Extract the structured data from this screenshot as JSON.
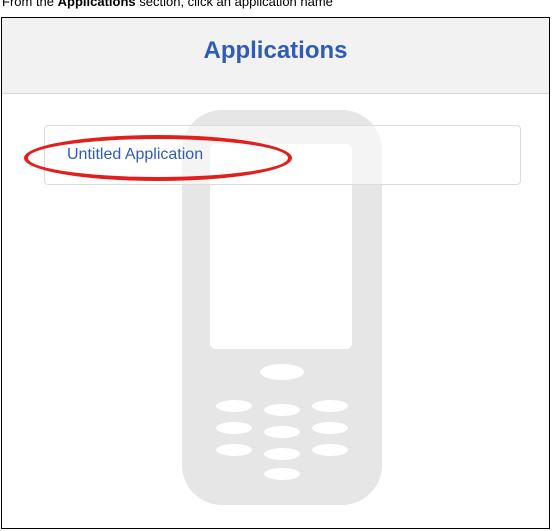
{
  "instruction": {
    "prefix": "From the ",
    "emphasis": "Applications",
    "suffix": " section, click an application name"
  },
  "panel": {
    "title": "Applications",
    "items": [
      {
        "label": "Untitled Application"
      }
    ],
    "watermark_icon": "mobile-phone-icon"
  },
  "colors": {
    "title_blue": "#2e5cb8",
    "highlight_red": "#e1201e",
    "header_bg": "#f2f2f2",
    "watermark_gray": "#e6e6e6"
  }
}
